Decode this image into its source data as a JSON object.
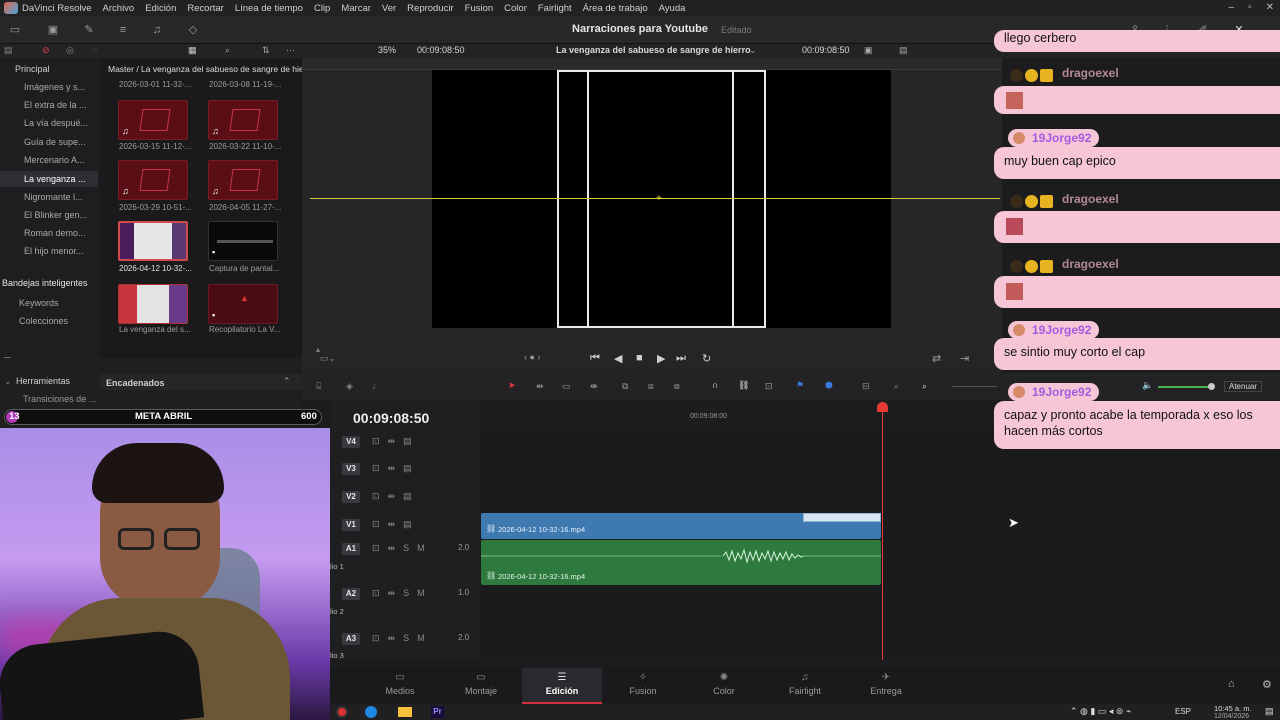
{
  "app": {
    "name": "DaVinci Resolve",
    "project_title": "Narraciones para Youtube",
    "project_status": "Editado"
  },
  "menu": [
    "Archivo",
    "Edición",
    "Recortar",
    "Línea de tiempo",
    "Clip",
    "Marcar",
    "Ver",
    "Reproducir",
    "Fusion",
    "Color",
    "Fairlight",
    "Área de trabajo",
    "Ayuda"
  ],
  "viewer": {
    "zoom": "35%",
    "source_timecode": "00:09:08:50",
    "timeline_name": "La venganza del sabueso de sangre de hierro",
    "timeline_timecode": "00:09:08:50"
  },
  "sidebar": {
    "header": "Principal",
    "items": [
      "Imágenes y s...",
      "El extra de la ...",
      "La vía despué...",
      "Guía de supe...",
      "Mercenario A...",
      "La venganza ...",
      "Nigromante l...",
      "El Blinker gen...",
      "Roman demo...",
      "El hijo menor..."
    ],
    "smart_bins_header": "Bandejas inteligentes",
    "smart_bins": [
      "Keywords",
      "Colecciones"
    ]
  },
  "media_pool": {
    "path": "Master / La venganza del sabueso de sangre de hierro",
    "top_labels": [
      "2026-03-01 11-32-...",
      "2026-03-08 11-19-..."
    ],
    "clips": [
      {
        "label": "2026-03-15 11-12-..."
      },
      {
        "label": "2026-03-22 11-10-..."
      },
      {
        "label": "2026-03-29 10-51-..."
      },
      {
        "label": "2026-04-05 11-27-..."
      },
      {
        "label": "2026-04-12 10-32-..."
      },
      {
        "label": "Captura de pantal..."
      },
      {
        "label": "La venganza del s..."
      },
      {
        "label": "Recopilatorio La V..."
      }
    ]
  },
  "effects": {
    "tools_header": "Herramientas",
    "chained_header": "Encadenados",
    "item": "Transiciones de ..."
  },
  "goal": {
    "count": "13",
    "label": "META ABRIL",
    "target": "600",
    "progress": 0.022
  },
  "timeline": {
    "timecode": "00:09:08:50",
    "ruler_mark": "00:09:08:00",
    "mute_label": "Atenuar",
    "video_tracks": [
      "V4",
      "V3",
      "V2",
      "V1"
    ],
    "audio_tracks": [
      {
        "id": "A1",
        "level": "2.0",
        "name": "lio 1"
      },
      {
        "id": "A2",
        "level": "1.0",
        "name": "lio 2"
      },
      {
        "id": "A3",
        "level": "2.0",
        "name": "lio 3"
      }
    ],
    "video_clip": "2026-04-12 10-32-16.mp4",
    "audio_clip": "2026-04-12 10-32-16.mp4"
  },
  "pages": [
    {
      "label": "Medios",
      "icon": "media-icon"
    },
    {
      "label": "Montaje",
      "icon": "cut-icon"
    },
    {
      "label": "Edición",
      "icon": "edit-icon"
    },
    {
      "label": "Fusion",
      "icon": "fusion-icon"
    },
    {
      "label": "Color",
      "icon": "color-icon"
    },
    {
      "label": "Fairlight",
      "icon": "fairlight-icon"
    },
    {
      "label": "Entrega",
      "icon": "deliver-icon"
    }
  ],
  "taskbar": {
    "lang": "ESP",
    "time": "10:45 a. m.",
    "date": "12/04/2026"
  },
  "chat": [
    {
      "user": "",
      "text": "llego cerbero"
    },
    {
      "user": "dragoexel",
      "text": ""
    },
    {
      "user": "19Jorge92",
      "text": "muy buen cap epico"
    },
    {
      "user": "dragoexel",
      "text": ""
    },
    {
      "user": "dragoexel",
      "text": ""
    },
    {
      "user": "19Jorge92",
      "text": "se sintio muy corto el cap"
    },
    {
      "user": "19Jorge92",
      "text": "capaz y pronto acabe la temporada x eso los hacen más cortos"
    }
  ],
  "colors": {
    "accent_red": "#e53935",
    "video_clip": "#3e7ab0",
    "audio_clip": "#2e7a3e",
    "chat_bg": "#f6c6d6",
    "chat_name": "#a45be0"
  }
}
